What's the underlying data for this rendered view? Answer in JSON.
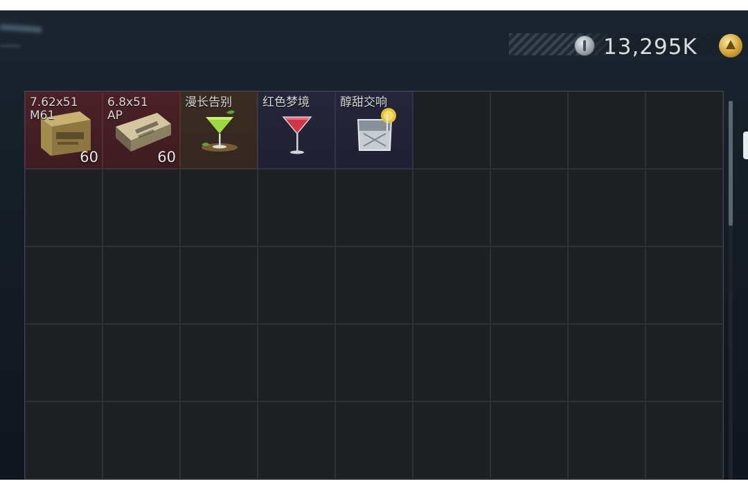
{
  "header": {
    "coin_icon": "silver-coin-icon",
    "coin_amount": "13,295K",
    "gold_icon": "gold-triangle-coin-icon"
  },
  "inventory": {
    "columns": 9,
    "rows": 5,
    "items": [
      {
        "name": "7.62x51\nM61",
        "count": "60",
        "icon": "ammo-box-icon",
        "color": "#4a2127"
      },
      {
        "name": "6.8x51\nAP",
        "count": "60",
        "icon": "ammo-box-icon",
        "color": "#4a2127"
      },
      {
        "name": "漫长告别",
        "count": "",
        "icon": "green-cocktail-icon",
        "color": "#3b2c22"
      },
      {
        "name": "红色梦境",
        "count": "",
        "icon": "red-cocktail-icon",
        "color": "#25263a"
      },
      {
        "name": "醇甜交响",
        "count": "",
        "icon": "whiskey-glass-icon",
        "color": "#25263a"
      }
    ]
  }
}
